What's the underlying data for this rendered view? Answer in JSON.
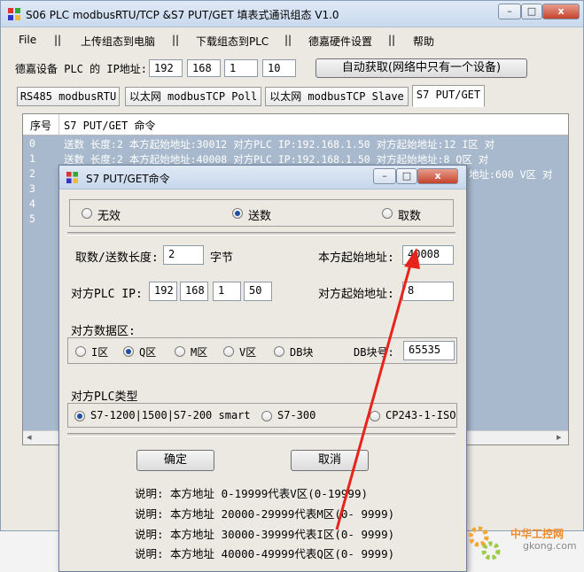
{
  "main": {
    "title": "S06 PLC modbusRTU/TCP &S7 PUT/GET 填表式通讯组态 V1.0",
    "caption_min": "–",
    "caption_max": "□",
    "caption_close": "x",
    "menu": [
      {
        "label": "File"
      },
      {
        "label": "上传组态到电脑"
      },
      {
        "label": "下载组态到PLC"
      },
      {
        "label": "德嘉硬件设置"
      },
      {
        "label": "帮助"
      }
    ],
    "menu_sep": "||",
    "ip_label": "德嘉设备 PLC 的 IP地址:",
    "ip": [
      "192",
      "168",
      "1",
      "10"
    ],
    "auto_button": "自动获取(网络中只有一个设备)",
    "tabs": [
      {
        "label": "RS485 modbusRTU"
      },
      {
        "label": "以太网 modbusTCP Poll"
      },
      {
        "label": "以太网 modbusTCP Slave"
      },
      {
        "label": "S7 PUT/GET"
      }
    ],
    "grid": {
      "headers": [
        "序号",
        "S7 PUT/GET 命令"
      ],
      "rows": [
        {
          "idx": "0",
          "text": "送数  长度:2  本方起始地址:30012  对方PLC IP:192.168.1.50     对方起始地址:12  I区  对"
        },
        {
          "idx": "1",
          "text": "送数  长度:2  本方起始地址:40008  对方PLC IP:192.168.1.50     对方起始地址:8  Q区  对"
        },
        {
          "idx": "2",
          "text": "地址:600  V区  对"
        },
        {
          "idx": "3",
          "text": ""
        },
        {
          "idx": "4",
          "text": ""
        },
        {
          "idx": "5",
          "text": ""
        }
      ]
    },
    "scroll_left": "◂",
    "scroll_right": "▸"
  },
  "dialog": {
    "title": "S7 PUT/GET命令",
    "mode_options": [
      {
        "label": "无效",
        "selected": false
      },
      {
        "label": "送数",
        "selected": true
      },
      {
        "label": "取数",
        "selected": false
      }
    ],
    "length_label": "取数/送数长度:",
    "length_value": "2",
    "length_unit": "字节",
    "local_addr_label": "本方起始地址:",
    "local_addr_value": "40008",
    "remote_ip_label": "对方PLC IP:",
    "remote_ip": [
      "192",
      "168",
      "1",
      "50"
    ],
    "remote_addr_label": "对方起始地址:",
    "remote_addr_value": "8",
    "area_label": "对方数据区:",
    "areas": [
      {
        "label": "I区",
        "selected": false
      },
      {
        "label": "Q区",
        "selected": true
      },
      {
        "label": "M区",
        "selected": false
      },
      {
        "label": "V区",
        "selected": false
      },
      {
        "label": "DB块",
        "selected": false
      }
    ],
    "db_label": "DB块号:",
    "db_value": "65535",
    "plc_type_label": "对方PLC类型",
    "plc_types": [
      {
        "label": "S7-1200|1500|S7-200 smart",
        "selected": true
      },
      {
        "label": "S7-300",
        "selected": false
      },
      {
        "label": "CP243-1-ISO",
        "selected": false
      }
    ],
    "ok_button": "确定",
    "cancel_button": "取消",
    "notes": [
      "说明: 本方地址   0-19999代表V区(0-19999)",
      "说明: 本方地址 20000-29999代表M区(0- 9999)",
      "说明: 本方地址 30000-39999代表I区(0- 9999)",
      "说明: 本方地址 40000-49999代表Q区(0- 9999)"
    ]
  },
  "watermark": {
    "text1": "中华工控网",
    "text2": "gkong.com"
  },
  "colors": {
    "annotation_arrow": "#e8231b",
    "grid_bg": "#a8b9cd",
    "selection": "#1f4f9e"
  }
}
